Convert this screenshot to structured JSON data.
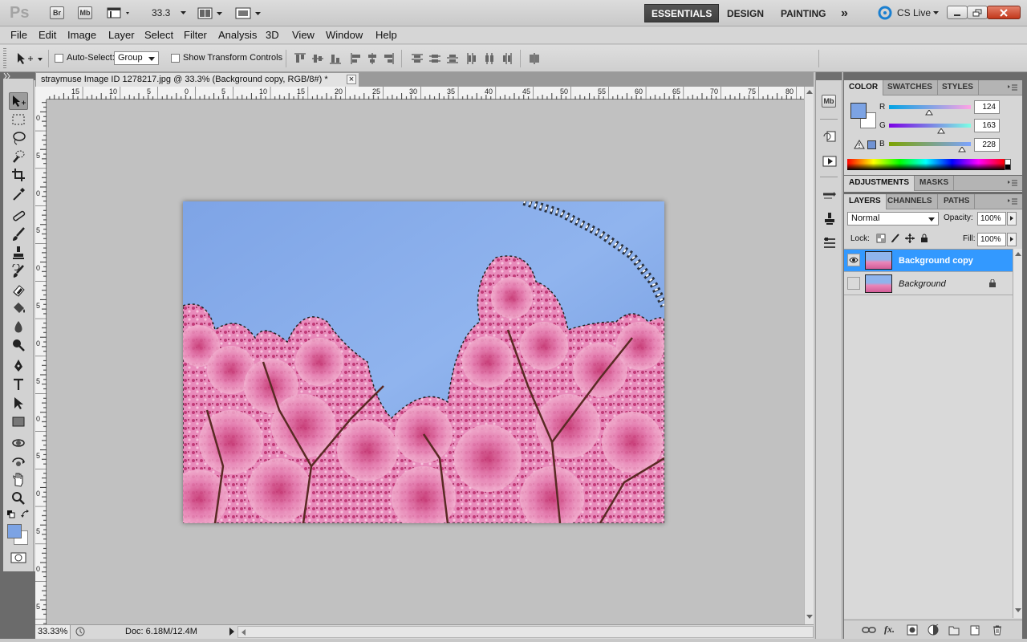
{
  "appbar": {
    "logo": "Ps",
    "bridge_badge": "Br",
    "minibridge_badge": "Mb",
    "zoom": "33.3",
    "workspaces": [
      "ESSENTIALS",
      "DESIGN",
      "PAINTING"
    ],
    "more": "»",
    "cs_live": "CS Live"
  },
  "menu": [
    "File",
    "Edit",
    "Image",
    "Layer",
    "Select",
    "Filter",
    "Analysis",
    "3D",
    "View",
    "Window",
    "Help"
  ],
  "options": {
    "auto_select_label": "Auto-Select:",
    "auto_select_value": "Group",
    "show_transform_label": "Show Transform Controls"
  },
  "document": {
    "tab_title": "straymuse Image ID 1278217.jpg @ 33.3% (Background copy, RGB/8#) *",
    "close": "×",
    "ruler_h": [
      "15",
      "10",
      "5",
      "0",
      "5",
      "10",
      "15",
      "20",
      "25",
      "30",
      "35",
      "40",
      "45",
      "50",
      "55",
      "60",
      "65",
      "70",
      "75",
      "80"
    ],
    "ruler_v": [
      "0",
      "5",
      "0",
      "5",
      "0",
      "5",
      "0",
      "5",
      "0",
      "5",
      "0",
      "5",
      "0",
      "5",
      "0"
    ],
    "status_zoom": "33.33%",
    "status_doc": "Doc: 6.18M/12.4M"
  },
  "color_panel": {
    "tabs": [
      "COLOR",
      "SWATCHES",
      "STYLES"
    ],
    "r_label": "R",
    "g_label": "G",
    "b_label": "B",
    "r": "124",
    "g": "163",
    "b": "228",
    "r_level": 0.49,
    "g_level": 0.64,
    "b_level": 0.89,
    "fg_color": "#7ca3e4",
    "bg_color": "#ffffff"
  },
  "adjust_panel": {
    "tabs": [
      "ADJUSTMENTS",
      "MASKS"
    ]
  },
  "layers_panel": {
    "tabs": [
      "LAYERS",
      "CHANNELS",
      "PATHS"
    ],
    "blend_mode": "Normal",
    "opacity_label": "Opacity:",
    "opacity": "100%",
    "lock_label": "Lock:",
    "fill_label": "Fill:",
    "fill": "100%",
    "layers": [
      {
        "name": "Background copy",
        "selected": true,
        "visible": true
      },
      {
        "name": "Background",
        "selected": false,
        "visible": false,
        "locked": true
      }
    ],
    "footer_fx": "fx."
  },
  "colors": {
    "accent": "#3d9ef2",
    "selection": "#3399ff"
  }
}
